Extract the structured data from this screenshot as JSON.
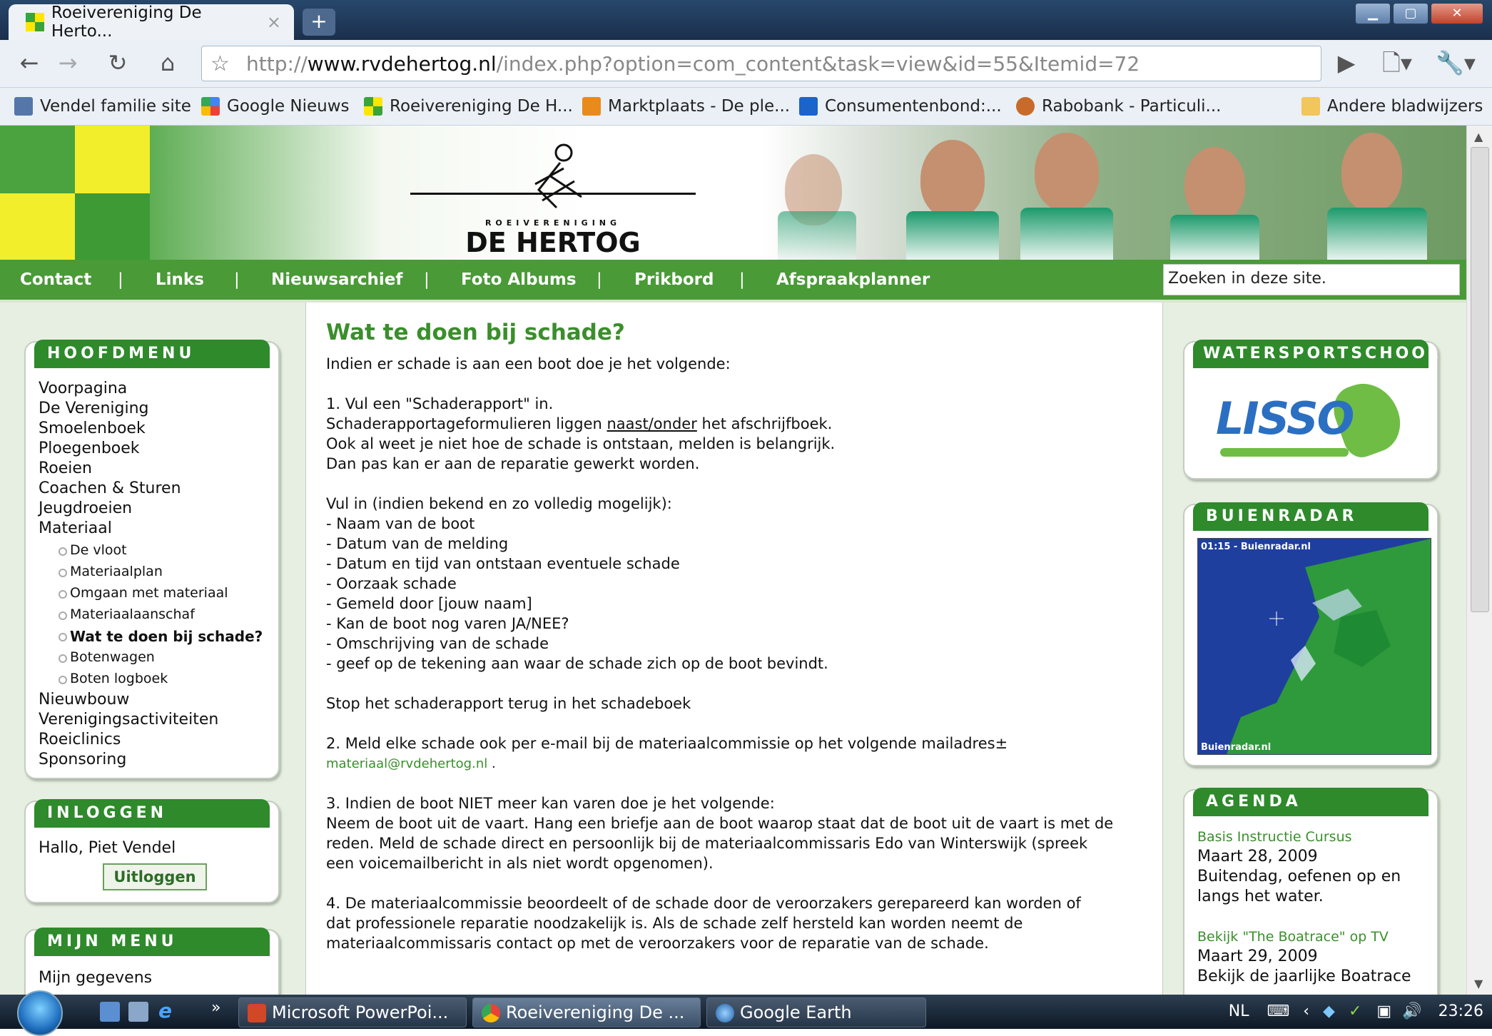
{
  "browser": {
    "tab_title": "Roeivereniging De Herto...",
    "tab_close": "×",
    "new_tab": "+",
    "url_scheme": "http://",
    "url_host": "www.rvdehertog.nl",
    "url_path": "/index.php?option=com_content&task=view&id=55&Itemid=72",
    "bookmarks": [
      "Vendel familie site",
      "Google Nieuws",
      "Roeivereniging De H...",
      "Marktplaats - De ple...",
      "Consumentenbond:...",
      "Rabobank - Particuli..."
    ],
    "other_bookmarks": "Andere bladwijzers"
  },
  "site": {
    "logo_small": "ROEIVERENIGING",
    "logo_main": "DE HERTOG",
    "nav": [
      "Contact",
      "Links",
      "Nieuwsarchief",
      "Foto Albums",
      "Prikbord",
      "Afspraakplanner"
    ],
    "nav_separator": "|",
    "search_value": "Zoeken in deze site."
  },
  "hoofdmenu": {
    "title": "HOOFDMENU",
    "items": [
      "Voorpagina",
      "De Vereniging",
      "Smoelenboek",
      "Ploegenboek",
      "Roeien",
      "Coachen & Sturen",
      "Jeugdroeien",
      "Materiaal"
    ],
    "sub_items": [
      "De vloot",
      "Materiaalplan",
      "Omgaan met materiaal",
      "Materiaalaanschaf",
      "Wat te doen bij schade?",
      "Botenwagen",
      "Boten logboek"
    ],
    "items_after": [
      "Nieuwbouw",
      "Verenigingsactiviteiten",
      "Roeiclinics",
      "Sponsoring"
    ]
  },
  "inloggen": {
    "title": "INLOGGEN",
    "greeting": "Hallo, Piet Vendel",
    "logout": "Uitloggen"
  },
  "mijnmenu": {
    "title": "MIJN MENU",
    "items": [
      "Mijn gegevens"
    ]
  },
  "article": {
    "title": "Wat te doen bij schade?",
    "intro": "Indien er schade is aan een boot doe je het volgende:",
    "step1_title": "1. Vul een \"Schaderapport\" in.",
    "step1_line1_a": "Schaderapportageformulieren liggen ",
    "step1_line1_u": "naast/onder",
    "step1_line1_b": " het afschrijfboek.",
    "step1_line2": "Ook al weet je niet hoe de schade is ontstaan, melden is belangrijk.",
    "step1_line3": "Dan pas kan er aan de reparatie gewerkt worden.",
    "fill_in": "Vul in (indien bekend en zo volledig mogelijk):",
    "fields": [
      "- Naam van de boot",
      "- Datum van de melding",
      "- Datum en tijd van ontstaan eventuele schade",
      "- Oorzaak schade",
      "- Gemeld door [jouw naam]",
      "- Kan de boot nog varen JA/NEE?",
      "- Omschrijving van de schade",
      "- geef op de tekening aan waar de schade zich op de boot bevindt."
    ],
    "stop": "Stop het schaderapport terug in het schadeboek",
    "step2": "2. Meld elke schade ook per e-mail bij de materiaalcommissie op het volgende mailadres±",
    "email": "materiaal@rvdehertog.nl",
    "email_suffix": " .",
    "step3_title": "3. Indien de boot NIET meer kan varen doe je het volgende:",
    "step3_lines": [
      "Neem de boot uit de vaart. Hang een briefje aan de boot waarop staat dat de boot uit de vaart is met de",
      "reden. Meld de schade direct en persoonlijk bij de materiaalcommissaris Edo van Winterswijk (spreek",
      "een voicemailbericht in als niet wordt opgenomen)."
    ],
    "step4_lines": [
      "4. De materiaalcommissie beoordeelt of de schade door de veroorzakers gerepareerd kan worden of",
      "dat professionele reparatie noodzakelijk is. Als de schade zelf hersteld kan worden neemt de",
      "materiaalcommissaris contact op met de veroorzakers voor de reparatie van de schade."
    ]
  },
  "watersportschool": {
    "title": "WATERSPORTSCHOOL",
    "logo_text": "LISSO"
  },
  "buienradar": {
    "title": "BUIENRADAR",
    "time_label": "01:15 - Buienradar.nl",
    "footer_label": "Buienradar.nl"
  },
  "agenda": {
    "title": "AGENDA",
    "events": [
      {
        "link": "Basis Instructie Cursus",
        "date": "Maart 28, 2009",
        "desc": [
          "Buitendag, oefenen op en",
          "langs het water."
        ]
      },
      {
        "link": "Bekijk \"The Boatrace\" op TV",
        "date": "Maart 29, 2009",
        "desc": [
          "Bekijk de jaarlijke Boatrace"
        ]
      }
    ]
  },
  "taskbar": {
    "chevron": "»",
    "tasks": [
      "Microsoft PowerPoi...",
      "Roeivereniging De ...",
      "Google Earth"
    ],
    "lang": "NL",
    "clock": "23:26"
  },
  "colors": {
    "site_green": "#4a9a37",
    "box_header": "#2e8a2b",
    "link_green": "#3a8f2c"
  }
}
